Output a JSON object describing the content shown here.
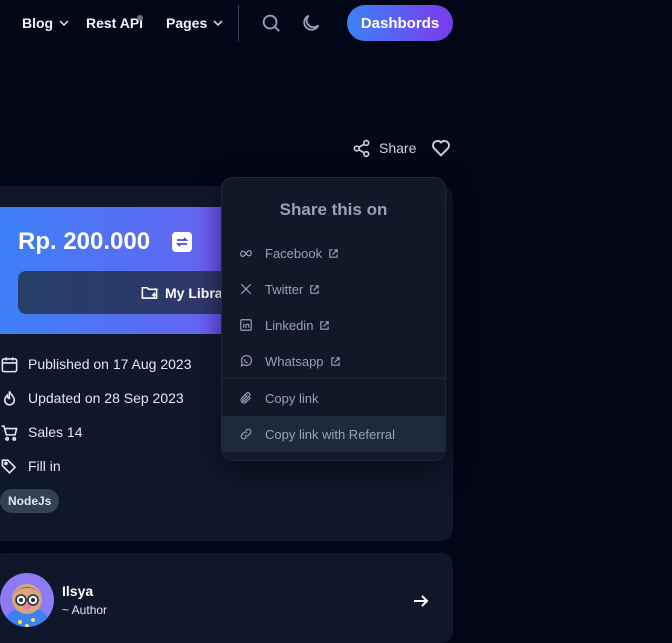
{
  "nav": {
    "blog": "Blog",
    "rest_api": "Rest API",
    "pages": "Pages",
    "dashboards": "Dashbords"
  },
  "share": {
    "label": "Share"
  },
  "dropdown": {
    "title": "Share this on",
    "items": [
      {
        "label": "Facebook",
        "icon": "meta-icon"
      },
      {
        "label": "Twitter",
        "icon": "x-icon"
      },
      {
        "label": "Linkedin",
        "icon": "linkedin-icon"
      },
      {
        "label": "Whatsapp",
        "icon": "whatsapp-icon"
      },
      {
        "label": "Copy link",
        "icon": "paperclip-icon"
      },
      {
        "label": "Copy link with Referral",
        "icon": "link-icon"
      }
    ]
  },
  "product": {
    "price": "Rp. 200.000",
    "library_button": "My Libra",
    "published": "Published on 17 Aug 2023",
    "updated": "Updated on 28 Sep 2023",
    "sales": "Sales 14",
    "fill_in": "Fill in",
    "tag": "NodeJs"
  },
  "author": {
    "name": "Ilsya",
    "role": "~ Author"
  },
  "colors": {
    "background": "#020617",
    "card": "#0f172a",
    "accent_start": "#3b82f6",
    "accent_end": "#7c3aed"
  }
}
